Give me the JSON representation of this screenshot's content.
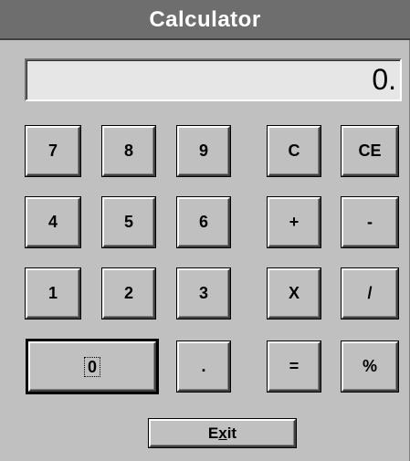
{
  "window": {
    "title": "Calculator"
  },
  "display": {
    "value": "0."
  },
  "buttons": {
    "seven": "7",
    "eight": "8",
    "nine": "9",
    "clear": "C",
    "clear_entry": "CE",
    "four": "4",
    "five": "5",
    "six": "6",
    "add": "+",
    "subtract": "-",
    "one": "1",
    "two": "2",
    "three": "3",
    "multiply": "X",
    "divide": "/",
    "zero": "0",
    "decimal": ".",
    "equals": "=",
    "percent": "%"
  },
  "exit": {
    "label_pre": "E",
    "label_accel": "x",
    "label_post": "it"
  }
}
